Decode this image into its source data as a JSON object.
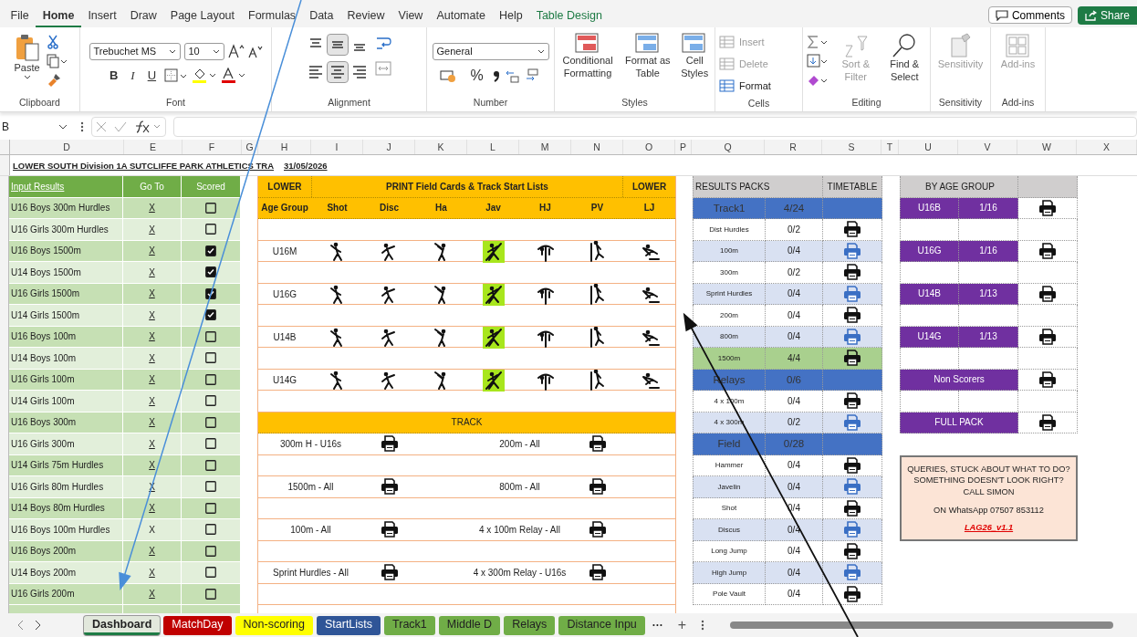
{
  "menu_tabs": [
    {
      "label": "File",
      "selected": false,
      "kind": "standard"
    },
    {
      "label": "Home",
      "selected": true,
      "kind": "standard"
    },
    {
      "label": "Insert",
      "selected": false,
      "kind": "standard"
    },
    {
      "label": "Draw",
      "selected": false,
      "kind": "standard"
    },
    {
      "label": "Page Layout",
      "selected": false,
      "kind": "standard"
    },
    {
      "label": "Formulas",
      "selected": false,
      "kind": "standard"
    },
    {
      "label": "Data",
      "selected": false,
      "kind": "standard"
    },
    {
      "label": "Review",
      "selected": false,
      "kind": "standard"
    },
    {
      "label": "View",
      "selected": false,
      "kind": "standard"
    },
    {
      "label": "Automate",
      "selected": false,
      "kind": "standard"
    },
    {
      "label": "Help",
      "selected": false,
      "kind": "standard"
    },
    {
      "label": "Table Design",
      "selected": false,
      "kind": "contextual"
    }
  ],
  "comments_button": "Comments",
  "share_button": "Share",
  "ribbon": {
    "clipboard": {
      "paste": "Paste",
      "label": "Clipboard"
    },
    "font": {
      "name": "Trebuchet MS",
      "size": "10",
      "bold": "B",
      "italic": "I",
      "underline": "U",
      "label": "Font"
    },
    "alignment": {
      "label": "Alignment",
      "buttons": [
        {
          "kind": "top",
          "selected": false
        },
        {
          "kind": "middle",
          "selected": true
        },
        {
          "kind": "bottom",
          "selected": false
        },
        {
          "kind": "left",
          "selected": false
        },
        {
          "kind": "center",
          "selected": true
        },
        {
          "kind": "right",
          "selected": false
        }
      ]
    },
    "number": {
      "format": "General",
      "percent": "%",
      "label": "Number"
    },
    "styles": {
      "items": [
        "Conditional Formatting",
        "Format as Table",
        "Cell Styles"
      ],
      "label": "Styles"
    },
    "cells": {
      "items": [
        {
          "label": "Insert",
          "disabled": true
        },
        {
          "label": "Delete",
          "disabled": true
        },
        {
          "label": "Format",
          "disabled": false
        }
      ],
      "label": "Cells"
    },
    "editing": {
      "items": [
        {
          "label": "Sort & Filter",
          "disabled": true
        },
        {
          "label": "Find & Select",
          "disabled": false
        }
      ],
      "label": "Editing"
    },
    "sensitivity": {
      "button": {
        "label": "Sensitivity",
        "disabled": true
      },
      "label": "Sensitivity"
    },
    "addins": {
      "button": {
        "label": "Add-ins",
        "disabled": true
      },
      "label": "Add-ins"
    }
  },
  "name_box": "B",
  "column_headers": [
    "D",
    "E",
    "F",
    "G",
    "H",
    "I",
    "J",
    "K",
    "L",
    "M",
    "N",
    "O",
    "P",
    "Q",
    "R",
    "S",
    "T",
    "U",
    "V",
    "W",
    "X"
  ],
  "sheet_title": "LOWER SOUTH Division 1A SUTCLIFFE PARK ATHLETICS TRA",
  "sheet_date": "31/05/2026",
  "results_input": {
    "columns": [
      "Input Results",
      "Go To",
      "Scored"
    ],
    "rows": [
      {
        "name": "U16 Boys 300m Hurdles",
        "goto": "X",
        "linked": true,
        "checked": false
      },
      {
        "name": "U16 Girls 300m Hurdles",
        "goto": "X",
        "linked": true,
        "checked": false
      },
      {
        "name": "U16 Boys 1500m",
        "goto": "X",
        "linked": true,
        "checked": true
      },
      {
        "name": "U14 Boys 1500m",
        "goto": "X",
        "linked": true,
        "checked": true
      },
      {
        "name": "U16 Girls 1500m",
        "goto": "X",
        "linked": true,
        "checked": true
      },
      {
        "name": "U14 Girls 1500m",
        "goto": "X",
        "linked": true,
        "checked": true
      },
      {
        "name": "U16 Boys 100m",
        "goto": "X",
        "linked": true,
        "checked": false
      },
      {
        "name": "U14 Boys 100m",
        "goto": "X",
        "linked": true,
        "checked": false
      },
      {
        "name": "U16 Girls 100m",
        "goto": "X",
        "linked": true,
        "checked": false
      },
      {
        "name": "U14 Girls 100m",
        "goto": "X",
        "linked": true,
        "checked": false
      },
      {
        "name": "U16 Boys 300m",
        "goto": "X",
        "linked": true,
        "checked": false
      },
      {
        "name": "U16 Girls 300m",
        "goto": "X",
        "linked": true,
        "checked": false
      },
      {
        "name": "U14 Girls 75m Hurdles",
        "goto": "X",
        "linked": true,
        "checked": false
      },
      {
        "name": "U16 Girls 80m Hurdles",
        "goto": "X",
        "linked": true,
        "checked": false
      },
      {
        "name": "U14 Boys 80m Hurdles",
        "goto": "X",
        "linked": true,
        "checked": false
      },
      {
        "name": "U16 Boys 100m Hurdles",
        "goto": "X",
        "linked": false,
        "checked": false
      },
      {
        "name": "U16 Boys 200m",
        "goto": "X",
        "linked": true,
        "checked": false
      },
      {
        "name": "U14 Boys 200m",
        "goto": "X",
        "linked": true,
        "checked": false
      },
      {
        "name": "U16 Girls 200m",
        "goto": "X",
        "linked": true,
        "checked": false
      }
    ]
  },
  "field_panel": {
    "title_left": "LOWER",
    "title": "PRINT Field Cards & Track Start Lists",
    "title_right": "LOWER",
    "age_header": "Age Group",
    "events": [
      {
        "label": "Shot",
        "kind": "shot",
        "highlighted": false
      },
      {
        "label": "Disc",
        "kind": "discus",
        "highlighted": false
      },
      {
        "label": "Ha",
        "kind": "hammer",
        "highlighted": false
      },
      {
        "label": "Jav",
        "kind": "javelin",
        "highlighted": true
      },
      {
        "label": "HJ",
        "kind": "highjump",
        "highlighted": false
      },
      {
        "label": "PV",
        "kind": "polevault",
        "highlighted": false
      },
      {
        "label": "LJ",
        "kind": "longjump",
        "highlighted": false
      }
    ],
    "age_groups": [
      "U16M",
      "U16G",
      "U14B",
      "U14G"
    ],
    "track_title": "TRACK",
    "track_rows": [
      {
        "left": "300m H - U16s",
        "right": "200m - All"
      },
      {
        "left": "1500m - All",
        "right": "800m - All"
      },
      {
        "left": "100m - All",
        "right": "4 x 100m Relay - All"
      },
      {
        "left": "Sprint Hurdles - All",
        "right": "4 x 300m Relay - U16s"
      }
    ]
  },
  "results_packs": {
    "title": "RESULTS PACKS",
    "timetable": "TIMETABLE",
    "rows": [
      {
        "kind": "section",
        "label": "Track1",
        "count": "4/24"
      },
      {
        "kind": "event",
        "label": "Dist Hurdles",
        "count": "0/2",
        "complete": false
      },
      {
        "kind": "event",
        "label": "100m",
        "count": "0/4",
        "complete": false
      },
      {
        "kind": "event",
        "label": "300m",
        "count": "0/2",
        "complete": false
      },
      {
        "kind": "event",
        "label": "Sprint Hurdles",
        "count": "0/4",
        "complete": false
      },
      {
        "kind": "event",
        "label": "200m",
        "count": "0/4",
        "complete": false
      },
      {
        "kind": "event",
        "label": "800m",
        "count": "0/4",
        "complete": false
      },
      {
        "kind": "event",
        "label": "1500m",
        "count": "4/4",
        "complete": true
      },
      {
        "kind": "section",
        "label": "Relays",
        "count": "0/6"
      },
      {
        "kind": "event",
        "label": "4 x 100m",
        "count": "0/4",
        "complete": false
      },
      {
        "kind": "event",
        "label": "4 x 300m",
        "count": "0/2",
        "complete": false
      },
      {
        "kind": "section",
        "label": "Field",
        "count": "0/28"
      },
      {
        "kind": "event",
        "label": "Hammer",
        "count": "0/4",
        "complete": false
      },
      {
        "kind": "event",
        "label": "Javelin",
        "count": "0/4",
        "complete": false
      },
      {
        "kind": "event",
        "label": "Shot",
        "count": "0/4",
        "complete": false
      },
      {
        "kind": "event",
        "label": "Discus",
        "count": "0/4",
        "complete": false
      },
      {
        "kind": "event",
        "label": "Long Jump",
        "count": "0/4",
        "complete": false
      },
      {
        "kind": "event",
        "label": "High Jump",
        "count": "0/4",
        "complete": false
      },
      {
        "kind": "event",
        "label": "Pole Vault",
        "count": "0/4",
        "complete": false
      }
    ]
  },
  "age_packs": {
    "title": "BY AGE GROUP",
    "rows": [
      {
        "kind": "group",
        "label": "U16B",
        "count": "1/16"
      },
      {
        "kind": "group",
        "label": "U16G",
        "count": "1/16"
      },
      {
        "kind": "group",
        "label": "U14B",
        "count": "1/13"
      },
      {
        "kind": "group",
        "label": "U14G",
        "count": "1/13"
      },
      {
        "kind": "wide",
        "label": "Non Scorers"
      },
      {
        "kind": "wide",
        "label": "FULL PACK"
      }
    ]
  },
  "help_note": {
    "text": "QUERIES, STUCK ABOUT WHAT TO DO? SOMETHING DOESN'T LOOK RIGHT?     CALL SIMON",
    "contact": "ON WhatsApp 07507 853112",
    "version": "LAG26_v1.1"
  },
  "sheet_tabs": [
    {
      "label": "Dashboard",
      "selected": true,
      "color": "#e2e8dc"
    },
    {
      "label": "MatchDay",
      "selected": false,
      "color": "#c00000"
    },
    {
      "label": "Non-scoring",
      "selected": false,
      "color": "#ffff00"
    },
    {
      "label": "StartLists",
      "selected": false,
      "color": "#2f5597"
    },
    {
      "label": "Track1",
      "selected": false,
      "color": "#70ad47"
    },
    {
      "label": "Middle D",
      "selected": false,
      "color": "#70ad47"
    },
    {
      "label": "Relays",
      "selected": false,
      "color": "#70ad47"
    },
    {
      "label": "Distance Inpu",
      "selected": false,
      "color": "#70ad47"
    }
  ],
  "more_tabs": "···",
  "add_sheet": "+"
}
